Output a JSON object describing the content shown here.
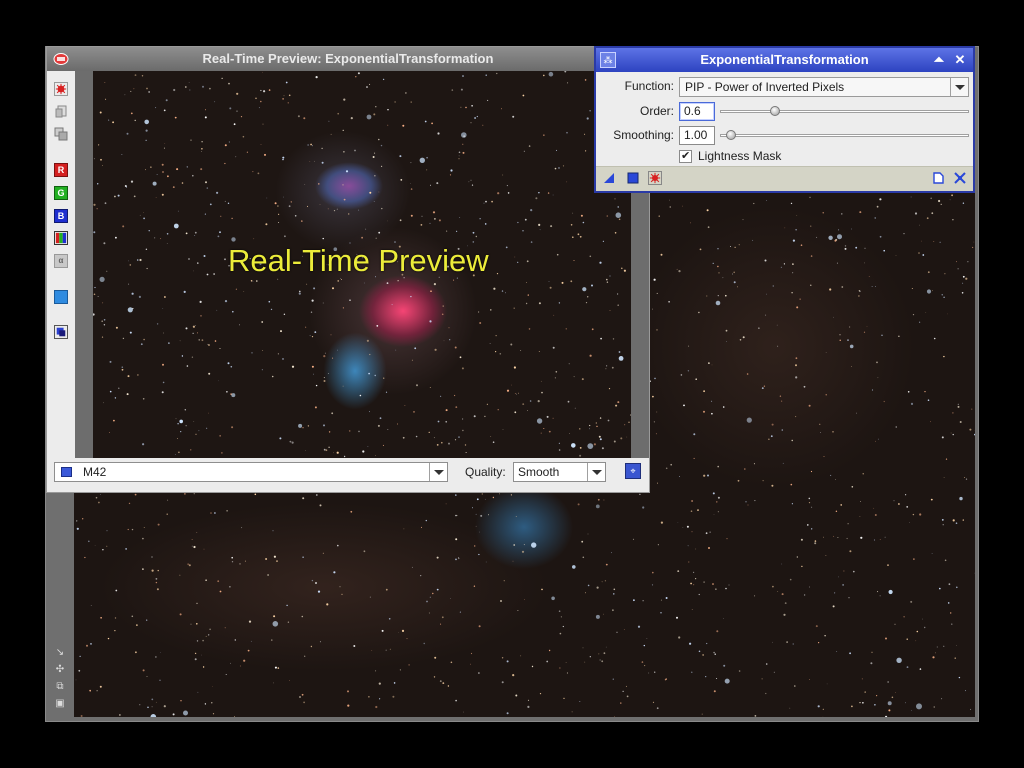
{
  "main_window": {
    "side_icons": [
      "resize-icon",
      "zoom-fit-icon",
      "restore-icon",
      "info-icon"
    ]
  },
  "preview_window": {
    "title": "Real-Time Preview: ExponentialTransformation",
    "overlay_label": "Real-Time Preview",
    "toolbar_icons": [
      "execute-icon",
      "clone-icon",
      "stack-icon",
      "channel-r-icon",
      "channel-g-icon",
      "channel-b-icon",
      "channel-rgb-icon",
      "alpha-channel-icon",
      "mask-icon",
      "view-mode-icon"
    ],
    "channel_labels": {
      "r": "R",
      "g": "G",
      "b": "B"
    },
    "view": {
      "selected": "M42"
    },
    "quality": {
      "label": "Quality:",
      "selected": "Smooth"
    }
  },
  "dialog": {
    "title": "ExponentialTransformation",
    "function": {
      "label": "Function:",
      "value": "PIP - Power of Inverted Pixels"
    },
    "order": {
      "label": "Order:",
      "value": "0.6",
      "slider_fraction": 0.12
    },
    "smoothing": {
      "label": "Smoothing:",
      "value": "1.00",
      "slider_fraction": 0.03
    },
    "lightness_mask": {
      "label": "Lightness Mask",
      "checked": true
    }
  },
  "colors": {
    "dialog_title_bar": "#3a52d4",
    "preview_title_bar": "#7c7c7c",
    "overlay_text": "#ecec3a",
    "channel_red": "#d42020",
    "channel_green": "#22b022",
    "channel_blue": "#1f2fd0"
  }
}
